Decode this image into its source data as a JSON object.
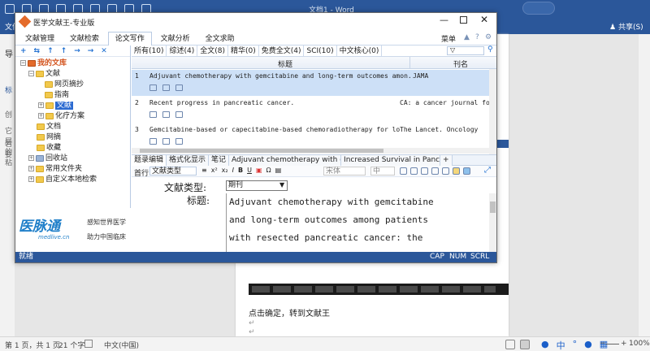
{
  "word": {
    "title": "文档1 - Word",
    "share": "共享(S)",
    "tab_file": "文件",
    "left_labels": [
      "导",
      "标",
      "创",
      "它层",
      "若要",
      "的粘"
    ],
    "status_pages": "第 1 页，共 1 页",
    "status_words": "21 个字",
    "status_lang": "中文(中国)",
    "zoom": "100%",
    "doc_text": "点击确定，转到文献王",
    "zoom_minus": "−",
    "zoom_plus": "+"
  },
  "app": {
    "title": "医学文献王-专业版",
    "menu": [
      "文献管理",
      "文献检索",
      "论文写作",
      "文献分析",
      "全文求助"
    ],
    "menu_active": 2,
    "menu_right": "菜单",
    "tree_toolbar": [
      "+",
      "⇆",
      "↑",
      "↑",
      "→",
      "→",
      "✕"
    ],
    "tree": {
      "root": "我的文库",
      "items": [
        {
          "label": "文献",
          "indent": 1,
          "pm": "−"
        },
        {
          "label": "网页摘抄",
          "indent": 2
        },
        {
          "label": "指南",
          "indent": 2
        },
        {
          "label": "文献",
          "indent": 2,
          "pm": "+",
          "selected": true
        },
        {
          "label": "化疗方案",
          "indent": 2,
          "pm": "+"
        },
        {
          "label": "文档",
          "indent": 1
        },
        {
          "label": "网摘",
          "indent": 1
        },
        {
          "label": "收藏",
          "indent": 1
        },
        {
          "label": "回收站",
          "indent": 0,
          "pm": "+"
        },
        {
          "label": "常用文件夹",
          "indent": 0,
          "pm": "+"
        },
        {
          "label": "自定义本地检索",
          "indent": 0,
          "pm": "+"
        }
      ]
    },
    "ad": {
      "brand": "医脉通",
      "site": "medlive.cn",
      "line1": "感知世界医学",
      "line2": "助力中国临床"
    },
    "filters": [
      "所有(10)",
      "综述(4)",
      "全文(8)",
      "精华(0)",
      "免费全文(4)",
      "SCI(10)",
      "中文核心(0)"
    ],
    "list_head": {
      "title": "标题",
      "journal": "刊名"
    },
    "rows": [
      {
        "no": "1",
        "title": "Adjuvant chemotherapy with gemcitabine and long-term outcomes amon...",
        "journal": "JAMA"
      },
      {
        "no": "2",
        "title": "Recent progress in pancreatic cancer.",
        "journal": "CA: a cancer journal for ..."
      },
      {
        "no": "3",
        "title": "Gemcitabine-based or capecitabine-based chemoradiotherapy for loca...",
        "journal": "The Lancet. Oncology"
      }
    ],
    "tabs": [
      "题录编辑",
      "格式化显示",
      "笔记",
      "Adjuvant chemotherapy with gemci...",
      "Increased Survival in Pancreatic..."
    ],
    "tab_add": "+",
    "fmt": {
      "first_line": "首行:",
      "field_type": "文献类型",
      "font": "宋体",
      "size": "中",
      "buttons": [
        "≡",
        "x²",
        "x₂",
        "I",
        "B",
        "U"
      ]
    },
    "editor": {
      "type_label": "文献类型:",
      "type_value": "期刊",
      "title_label": "标题:",
      "title_lines": [
        "Adjuvant chemotherapy with gemcitabine",
        "and long-term outcomes among patients",
        "with resected pancreatic cancer: the"
      ]
    },
    "status": {
      "left": "就绪",
      "cap": "CAP",
      "num": "NUM",
      "scrl": "SCRL"
    }
  }
}
